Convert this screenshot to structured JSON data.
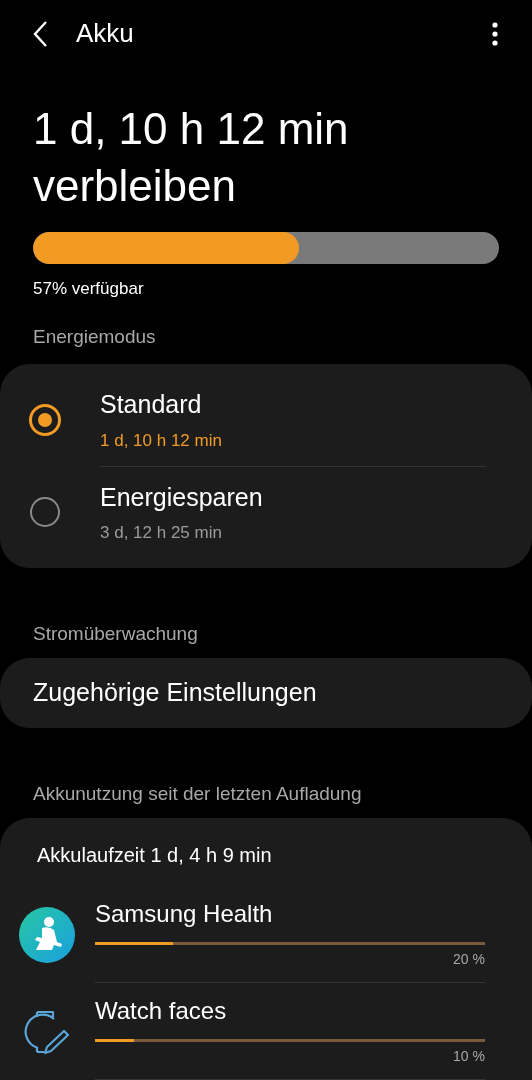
{
  "header": {
    "title": "Akku"
  },
  "battery": {
    "remaining": "1 d, 10 h 12 min verbleiben",
    "level": 0.57,
    "available": "57% verfügbar"
  },
  "power_mode": {
    "heading": "Energiemodus",
    "options": [
      {
        "name": "Standard",
        "time": "1 d, 10 h 12 min",
        "selected": true
      },
      {
        "name": "Energiesparen",
        "time": "3 d, 12 h 25 min",
        "selected": false
      }
    ]
  },
  "monitoring": {
    "heading": "Stromüberwachung",
    "item": "Zugehörige Einstellungen"
  },
  "usage": {
    "heading": "Akkunutzung seit der letzten Aufladung",
    "runtime": "Akkulaufzeit 1 d, 4 h 9 min",
    "apps": [
      {
        "kind": "health",
        "name": "Samsung Health",
        "level": 0.2,
        "percent": "20 %"
      },
      {
        "kind": "watch",
        "name": "Watch faces",
        "level": 0.1,
        "percent": "10 %"
      }
    ]
  }
}
